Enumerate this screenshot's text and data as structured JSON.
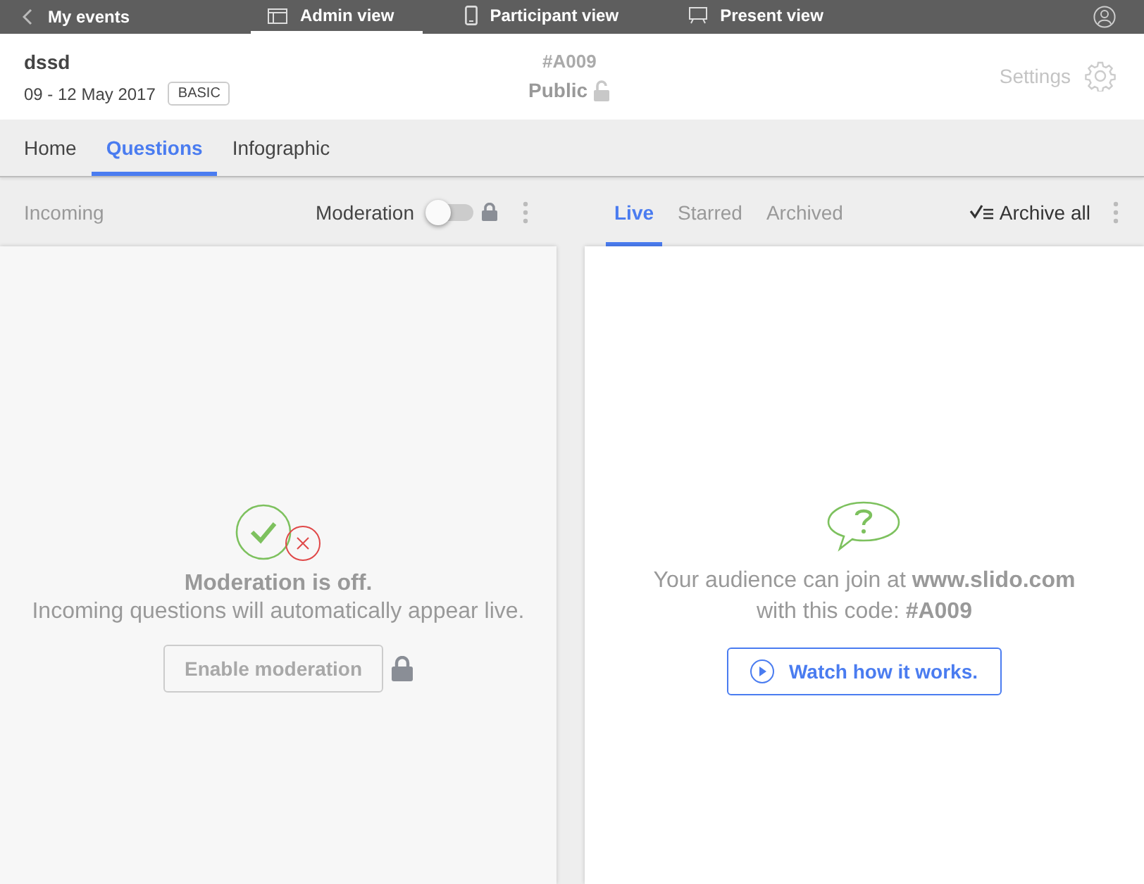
{
  "top_bar": {
    "back": "My events",
    "views": [
      {
        "label": "Admin view",
        "kind": "window",
        "selected": true
      },
      {
        "label": "Participant view",
        "kind": "phone",
        "selected": false
      },
      {
        "label": "Present view",
        "kind": "screen",
        "selected": false
      }
    ]
  },
  "event": {
    "name": "dssd",
    "dates": "09 - 12 May 2017",
    "plan": "BASIC",
    "code": "#A009",
    "visibility": "Public",
    "locked": false,
    "settings": "Settings"
  },
  "tabs": [
    {
      "label": "Home",
      "selected": false
    },
    {
      "label": "Questions",
      "selected": true
    },
    {
      "label": "Infographic",
      "selected": false
    }
  ],
  "incoming": {
    "title": "Incoming",
    "moderation_label": "Moderation",
    "moderation_on": false,
    "heading": "Moderation is off.",
    "message": "Incoming questions will automatically appear live.",
    "button": "Enable moderation"
  },
  "questions": {
    "tabs": [
      {
        "label": "Live",
        "selected": true
      },
      {
        "label": "Starred",
        "selected": false
      },
      {
        "label": "Archived",
        "selected": false
      }
    ],
    "archive": "Archive all",
    "join_text": "Your audience can join at **www.slido.com**",
    "code_text": "with this code: **#A009**",
    "button": "Watch how it works."
  }
}
